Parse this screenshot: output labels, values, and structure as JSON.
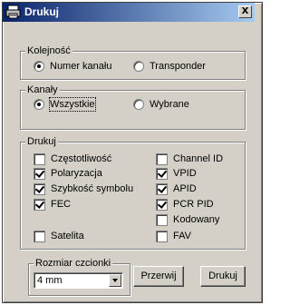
{
  "window": {
    "title": "Drukuj",
    "close_label": "X"
  },
  "kolejnosc": {
    "label": "Kolejność",
    "options": [
      {
        "label": "Numer kanału",
        "selected": true
      },
      {
        "label": "Transponder",
        "selected": false
      }
    ]
  },
  "kanaly": {
    "label": "Kanały",
    "options": [
      {
        "label": "Wszystkie",
        "selected": true
      },
      {
        "label": "Wybrane",
        "selected": false
      }
    ]
  },
  "drukuj": {
    "label": "Drukuj",
    "left": [
      {
        "label": "Częstotliwość",
        "checked": false
      },
      {
        "label": "Polaryzacja",
        "checked": true
      },
      {
        "label": "Szybkość symbolu",
        "checked": true
      },
      {
        "label": "FEC",
        "checked": true
      },
      {
        "label": "Satelita",
        "checked": false
      }
    ],
    "right": [
      {
        "label": "Channel ID",
        "checked": false
      },
      {
        "label": "VPID",
        "checked": true
      },
      {
        "label": "APID",
        "checked": true
      },
      {
        "label": "PCR PID",
        "checked": true
      },
      {
        "label": "Kodowany",
        "checked": false
      },
      {
        "label": "FAV",
        "checked": false
      }
    ]
  },
  "font_size": {
    "label": "Rozmiar czcionki",
    "value": "4 mm"
  },
  "buttons": {
    "cancel": "Przerwij",
    "print": "Drukuj"
  }
}
